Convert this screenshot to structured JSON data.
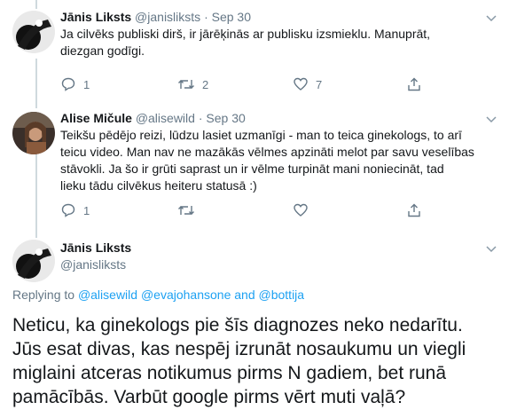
{
  "tweets": [
    {
      "name": "Jānis Liksts",
      "handle": "@janisliksts",
      "sep": "·",
      "date": "Sep 30",
      "text_lines": [
        "Ja cilvēks publiski dirš, ir jārēķinās ar publisku izsmieklu. Manuprāt,",
        "diezgan godīgi."
      ],
      "reply_count": "1",
      "retweet_count": "2",
      "like_count": "7"
    },
    {
      "name": "Alise Mičule",
      "handle": "@alisewild",
      "sep": "·",
      "date": "Sep 30",
      "text_lines": [
        "Teikšu pēdējo reizi, lūdzu lasiet uzmanīgi - man to teica ginekologs, to arī",
        "teicu video. Man nav ne mazākās vēlmes apzināti melot par savu veselības",
        "stāvokli. Ja šo ir grūti saprast un ir vēlme turpināt mani noniecināt, tad",
        "lieku tādu cilvēkus heiteru statusā :)"
      ],
      "reply_count": "1",
      "retweet_count": "",
      "like_count": ""
    }
  ],
  "main_tweet": {
    "name": "Jānis Liksts",
    "handle": "@janisliksts",
    "replying_prefix": "Replying to",
    "replying_to": [
      "@alisewild",
      "@evajohansone",
      "and",
      "@bottija"
    ],
    "text_lines": [
      "Neticu, ka ginekologs pie šīs diagnozes neko nedarītu.",
      "Jūs esat divas, kas nespēj izrunāt nosaukumu un viegli",
      "miglaini atceras notikumus pirms N gadiem, bet runā",
      "pamācībās. Varbūt google pirms vērt muti vaļā?"
    ]
  },
  "icons": {
    "chevron": "chevron-down-icon",
    "reply": "reply-icon",
    "retweet": "retweet-icon",
    "like": "heart-icon",
    "share": "share-icon"
  },
  "colors": {
    "link": "#1da1f2",
    "muted": "#657786",
    "text": "#14171a",
    "thread_line": "#cfd9de"
  }
}
